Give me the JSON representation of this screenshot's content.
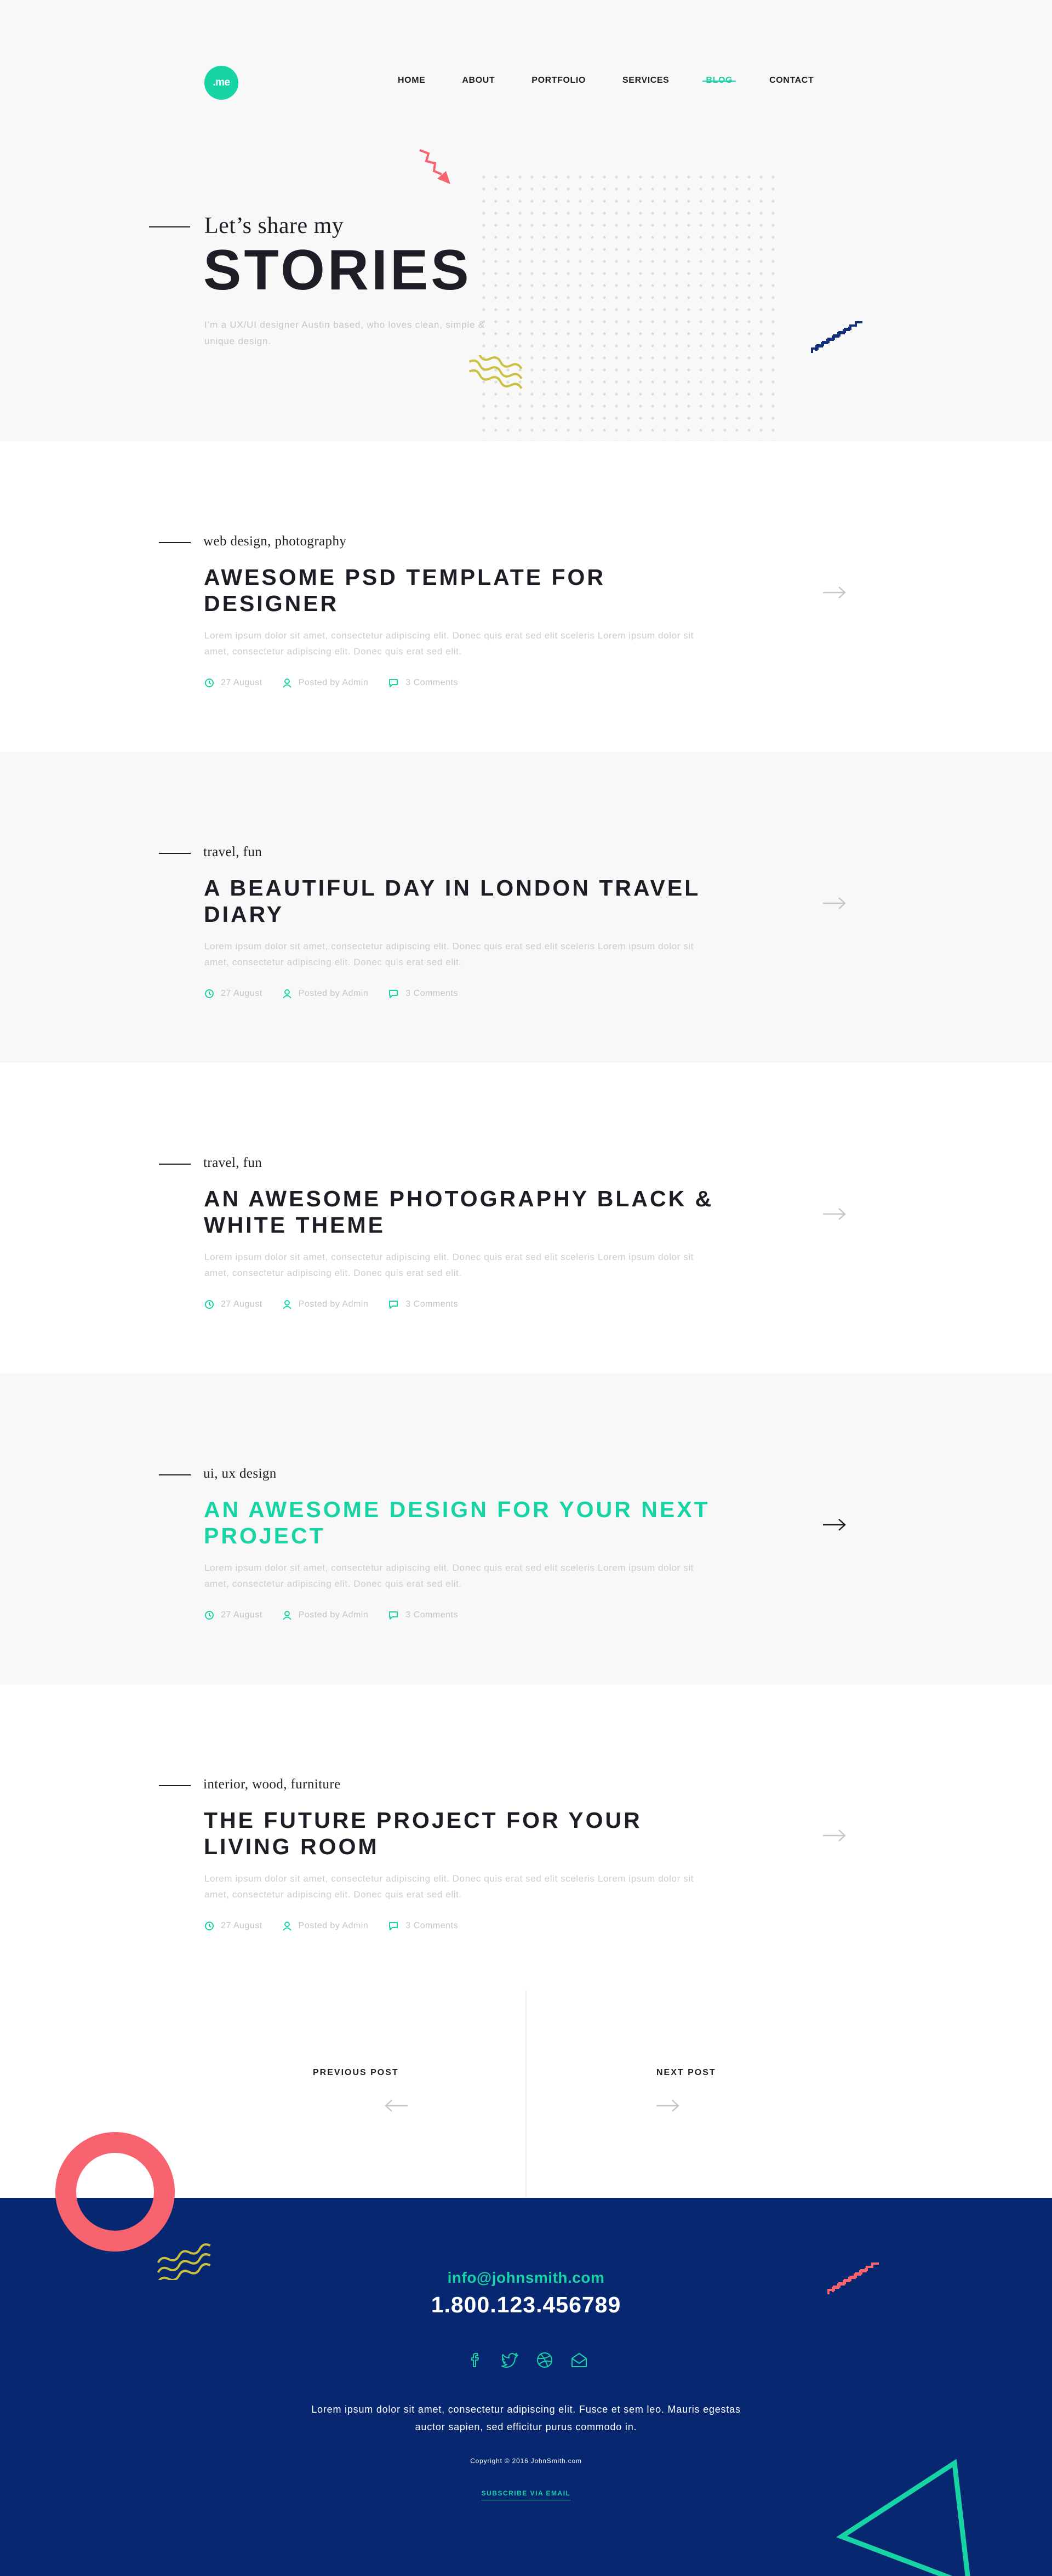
{
  "header": {
    "logo_text": ".me",
    "nav": [
      {
        "label": "HOME"
      },
      {
        "label": "ABOUT"
      },
      {
        "label": "PORTFOLIO"
      },
      {
        "label": "SERVICES"
      },
      {
        "label": "BLOG",
        "active": true
      },
      {
        "label": "CONTACT"
      }
    ]
  },
  "hero": {
    "subtitle": "Let’s share my",
    "title": "STORIES",
    "description": "I’m a UX/UI designer Austin based, who loves clean, simple & unique design."
  },
  "posts": [
    {
      "category": "web design, photography",
      "title": "AWESOME PSD TEMPLATE FOR DESIGNER",
      "excerpt": "Lorem ipsum dolor sit amet, consectetur adipiscing elit. Donec quis erat sed elit sceleris Lorem ipsum dolor sit amet, consectetur adipiscing elit. Donec quis erat sed elit.",
      "date": "27 August",
      "author": "Posted by Admin",
      "comments": "3 Comments"
    },
    {
      "category": "travel, fun",
      "title": "A BEAUTIFUL DAY IN LONDON TRAVEL DIARY",
      "excerpt": "Lorem ipsum dolor sit amet, consectetur adipiscing elit. Donec quis erat sed elit sceleris Lorem ipsum dolor sit amet, consectetur adipiscing elit. Donec quis erat sed elit.",
      "date": "27 August",
      "author": "Posted by Admin",
      "comments": "3 Comments"
    },
    {
      "category": "travel, fun",
      "title": "AN AWESOME PHOTOGRAPHY BLACK & WHITE THEME",
      "excerpt": "Lorem ipsum dolor sit amet, consectetur adipiscing elit. Donec quis erat sed elit sceleris Lorem ipsum dolor sit amet, consectetur adipiscing elit. Donec quis erat sed elit.",
      "date": "27 August",
      "author": "Posted by Admin",
      "comments": "3 Comments"
    },
    {
      "category": "ui, ux design",
      "title": "AN AWESOME DESIGN FOR YOUR NEXT PROJECT",
      "excerpt": "Lorem ipsum dolor sit amet, consectetur adipiscing elit. Donec quis erat sed elit sceleris Lorem ipsum dolor sit amet, consectetur adipiscing elit. Donec quis erat sed elit.",
      "date": "27 August",
      "author": "Posted by Admin",
      "comments": "3 Comments",
      "highlighted": true
    },
    {
      "category": "interior, wood, furniture",
      "title": "THE FUTURE PROJECT FOR YOUR LIVING ROOM",
      "excerpt": "Lorem ipsum dolor sit amet, consectetur adipiscing elit. Donec quis erat sed elit sceleris Lorem ipsum dolor sit amet, consectetur adipiscing elit. Donec quis erat sed elit.",
      "date": "27 August",
      "author": "Posted by Admin",
      "comments": "3 Comments"
    }
  ],
  "pagination": {
    "previous_label": "PREVIOUS POST",
    "next_label": "NEXT POST"
  },
  "footer": {
    "email": "info@johnsmith.com",
    "phone": "1.800.123.456789",
    "social_icons": [
      "facebook-icon",
      "twitter-icon",
      "dribbble-icon",
      "mail-icon"
    ],
    "text": "Lorem ipsum dolor sit amet, consectetur adipiscing elit. Fusce et sem leo. Mauris egestas auctor sapien, sed efficitur purus commodo in.",
    "copyright": "Copyright © 2016 JohnSmith.com",
    "subscribe_label": "SUBSCRIBE VIA EMAIL"
  },
  "colors": {
    "accent": "#17d4a5",
    "footer_bg": "#072871",
    "coral": "#f7636e",
    "mustard": "#c9c13f",
    "navy": "#15307a",
    "text_dark": "#1d1d25",
    "muted": "#c6c6c6"
  }
}
